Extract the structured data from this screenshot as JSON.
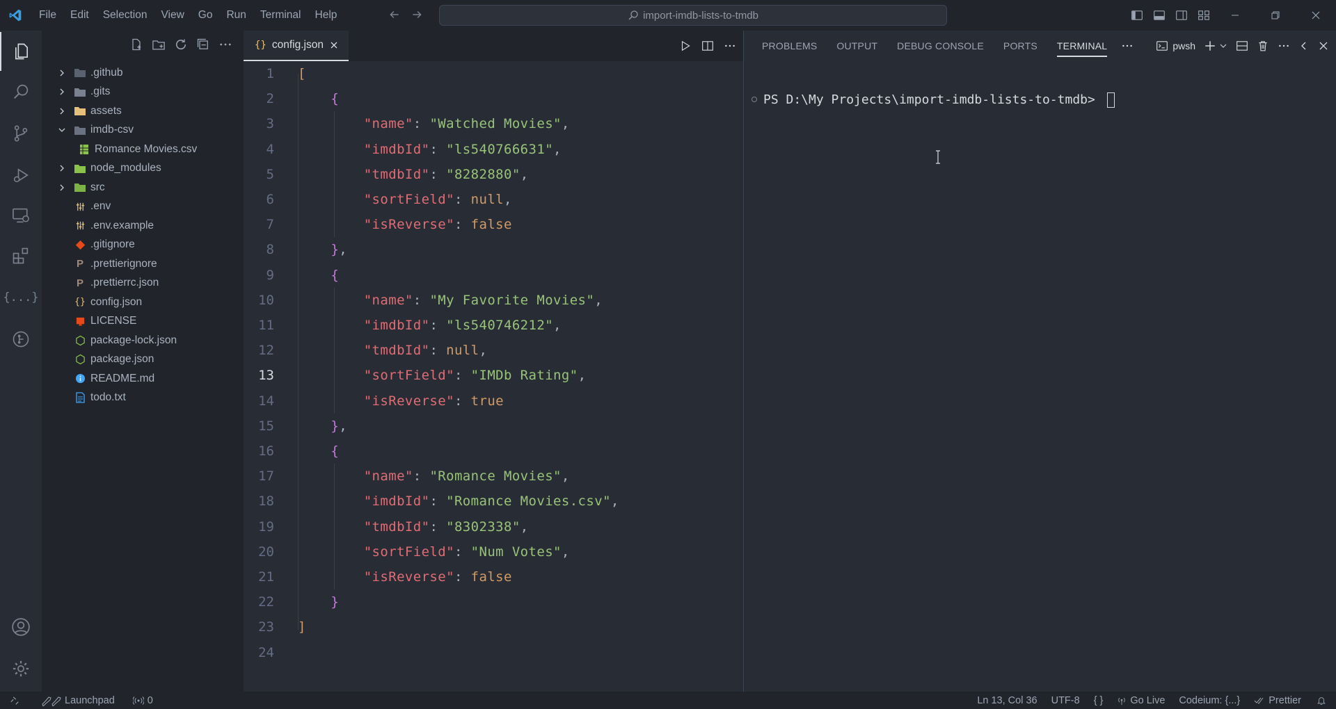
{
  "menu": [
    "File",
    "Edit",
    "Selection",
    "View",
    "Go",
    "Run",
    "Terminal",
    "Help"
  ],
  "search": {
    "text": "import-imdb-lists-to-tmdb"
  },
  "explorer": {
    "items": [
      {
        "label": ".github",
        "type": "folder",
        "icon": "github-folder-icon",
        "color": "#5a6270"
      },
      {
        "label": ".gits",
        "type": "folder",
        "icon": "folder-icon",
        "color": "#7a8190"
      },
      {
        "label": "assets",
        "type": "folder",
        "icon": "assets-folder-icon",
        "color": "#e5c07b"
      },
      {
        "label": "imdb-csv",
        "type": "folder-open",
        "icon": "folder-open-icon",
        "color": "#6b7383"
      },
      {
        "label": "Romance Movies.csv",
        "type": "file",
        "icon": "csv-icon",
        "color": "#8bc34a",
        "child": true
      },
      {
        "label": "node_modules",
        "type": "folder",
        "icon": "node-folder-icon",
        "color": "#8bc34a"
      },
      {
        "label": "src",
        "type": "folder",
        "icon": "src-folder-icon",
        "color": "#7cb342"
      },
      {
        "label": ".env",
        "type": "file",
        "icon": "env-icon",
        "color": "#e5c07b"
      },
      {
        "label": ".env.example",
        "type": "file",
        "icon": "env-icon",
        "color": "#e5c07b"
      },
      {
        "label": ".gitignore",
        "type": "file",
        "icon": "git-icon",
        "color": "#e64a19"
      },
      {
        "label": ".prettierignore",
        "type": "file",
        "icon": "prettier-icon",
        "color": "#9e8a7a"
      },
      {
        "label": ".prettierrc.json",
        "type": "file",
        "icon": "prettier-icon",
        "color": "#9e8a7a"
      },
      {
        "label": "config.json",
        "type": "file",
        "icon": "json-icon",
        "color": "#e5c07b"
      },
      {
        "label": "LICENSE",
        "type": "file",
        "icon": "license-icon",
        "color": "#e64a19"
      },
      {
        "label": "package-lock.json",
        "type": "file",
        "icon": "nodejs-icon",
        "color": "#8bc34a"
      },
      {
        "label": "package.json",
        "type": "file",
        "icon": "nodejs-icon",
        "color": "#8bc34a"
      },
      {
        "label": "README.md",
        "type": "file",
        "icon": "info-icon",
        "color": "#42a5f5"
      },
      {
        "label": "todo.txt",
        "type": "file",
        "icon": "text-file-icon",
        "color": "#42a5f5"
      }
    ]
  },
  "tab": {
    "label": "config.json"
  },
  "code": {
    "current_line": 13,
    "lines": [
      [
        [
          "b1",
          "["
        ]
      ],
      [
        [
          "i2",
          ""
        ],
        [
          "b2",
          "{"
        ]
      ],
      [
        [
          "i4",
          ""
        ],
        [
          "k",
          "\"name\""
        ],
        [
          "p",
          ": "
        ],
        [
          "s",
          "\"Watched Movies\""
        ],
        [
          "p",
          ","
        ]
      ],
      [
        [
          "i4",
          ""
        ],
        [
          "k",
          "\"imdbId\""
        ],
        [
          "p",
          ": "
        ],
        [
          "s",
          "\"ls540766631\""
        ],
        [
          "p",
          ","
        ]
      ],
      [
        [
          "i4",
          ""
        ],
        [
          "k",
          "\"tmdbId\""
        ],
        [
          "p",
          ": "
        ],
        [
          "s",
          "\"8282880\""
        ],
        [
          "p",
          ","
        ]
      ],
      [
        [
          "i4",
          ""
        ],
        [
          "k",
          "\"sortField\""
        ],
        [
          "p",
          ": "
        ],
        [
          "v",
          "null"
        ],
        [
          "p",
          ","
        ]
      ],
      [
        [
          "i4",
          ""
        ],
        [
          "k",
          "\"isReverse\""
        ],
        [
          "p",
          ": "
        ],
        [
          "v",
          "false"
        ]
      ],
      [
        [
          "i2",
          ""
        ],
        [
          "b2",
          "}"
        ],
        [
          "p",
          ","
        ]
      ],
      [
        [
          "i2",
          ""
        ],
        [
          "b2",
          "{"
        ]
      ],
      [
        [
          "i4",
          ""
        ],
        [
          "k",
          "\"name\""
        ],
        [
          "p",
          ": "
        ],
        [
          "s",
          "\"My Favorite Movies\""
        ],
        [
          "p",
          ","
        ]
      ],
      [
        [
          "i4",
          ""
        ],
        [
          "k",
          "\"imdbId\""
        ],
        [
          "p",
          ": "
        ],
        [
          "s",
          "\"ls540746212\""
        ],
        [
          "p",
          ","
        ]
      ],
      [
        [
          "i4",
          ""
        ],
        [
          "k",
          "\"tmdbId\""
        ],
        [
          "p",
          ": "
        ],
        [
          "v",
          "null"
        ],
        [
          "p",
          ","
        ]
      ],
      [
        [
          "i4",
          ""
        ],
        [
          "k",
          "\"sortField\""
        ],
        [
          "p",
          ": "
        ],
        [
          "s",
          "\"IMDb Rating\""
        ],
        [
          "p",
          ","
        ]
      ],
      [
        [
          "i4",
          ""
        ],
        [
          "k",
          "\"isReverse\""
        ],
        [
          "p",
          ": "
        ],
        [
          "v",
          "true"
        ]
      ],
      [
        [
          "i2",
          ""
        ],
        [
          "b2",
          "}"
        ],
        [
          "p",
          ","
        ]
      ],
      [
        [
          "i2",
          ""
        ],
        [
          "b2",
          "{"
        ]
      ],
      [
        [
          "i4",
          ""
        ],
        [
          "k",
          "\"name\""
        ],
        [
          "p",
          ": "
        ],
        [
          "s",
          "\"Romance Movies\""
        ],
        [
          "p",
          ","
        ]
      ],
      [
        [
          "i4",
          ""
        ],
        [
          "k",
          "\"imdbId\""
        ],
        [
          "p",
          ": "
        ],
        [
          "s",
          "\"Romance Movies.csv\""
        ],
        [
          "p",
          ","
        ]
      ],
      [
        [
          "i4",
          ""
        ],
        [
          "k",
          "\"tmdbId\""
        ],
        [
          "p",
          ": "
        ],
        [
          "s",
          "\"8302338\""
        ],
        [
          "p",
          ","
        ]
      ],
      [
        [
          "i4",
          ""
        ],
        [
          "k",
          "\"sortField\""
        ],
        [
          "p",
          ": "
        ],
        [
          "s",
          "\"Num Votes\""
        ],
        [
          "p",
          ","
        ]
      ],
      [
        [
          "i4",
          ""
        ],
        [
          "k",
          "\"isReverse\""
        ],
        [
          "p",
          ": "
        ],
        [
          "v",
          "false"
        ]
      ],
      [
        [
          "i2",
          ""
        ],
        [
          "b2",
          "}"
        ]
      ],
      [
        [
          "b1",
          "]"
        ]
      ],
      [
        [
          "p",
          ""
        ]
      ]
    ]
  },
  "panel": {
    "tabs": [
      "PROBLEMS",
      "OUTPUT",
      "DEBUG CONSOLE",
      "PORTS",
      "TERMINAL"
    ],
    "active": "TERMINAL",
    "shell": "pwsh",
    "prompt": "PS D:\\My Projects\\import-imdb-lists-to-tmdb> "
  },
  "status": {
    "launchpad": "Launchpad",
    "ports": "0",
    "position": "Ln 13, Col 36",
    "encoding": "UTF-8",
    "language": "{ }",
    "golive": "Go Live",
    "codeium": "Codeium: {...}",
    "prettier": "Prettier"
  }
}
